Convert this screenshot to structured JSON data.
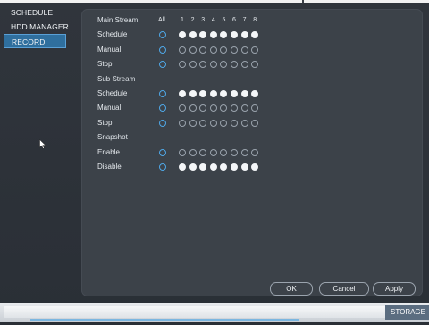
{
  "sidebar": {
    "items": [
      {
        "label": "SCHEDULE",
        "active": false
      },
      {
        "label": "HDD MANAGER",
        "active": false
      },
      {
        "label": "RECORD",
        "active": true
      }
    ]
  },
  "record": {
    "header": {
      "label": "Main Stream",
      "all_label": "All",
      "channels": [
        "1",
        "2",
        "3",
        "4",
        "5",
        "6",
        "7",
        "8"
      ]
    },
    "rows": [
      {
        "key": "main-schedule",
        "label": "Schedule",
        "all": false,
        "channels": [
          true,
          true,
          true,
          true,
          true,
          true,
          true,
          true
        ]
      },
      {
        "key": "main-manual",
        "label": "Manual",
        "all": false,
        "channels": [
          false,
          false,
          false,
          false,
          false,
          false,
          false,
          false
        ]
      },
      {
        "key": "main-stop",
        "label": "Stop",
        "all": false,
        "channels": [
          false,
          false,
          false,
          false,
          false,
          false,
          false,
          false
        ]
      },
      {
        "key": "sub-stream-heading",
        "label": "Sub Stream",
        "heading": true
      },
      {
        "key": "sub-schedule",
        "label": "Schedule",
        "all": false,
        "channels": [
          true,
          true,
          true,
          true,
          true,
          true,
          true,
          true
        ]
      },
      {
        "key": "sub-manual",
        "label": "Manual",
        "all": false,
        "channels": [
          false,
          false,
          false,
          false,
          false,
          false,
          false,
          false
        ]
      },
      {
        "key": "sub-stop",
        "label": "Stop",
        "all": false,
        "channels": [
          false,
          false,
          false,
          false,
          false,
          false,
          false,
          false
        ]
      },
      {
        "key": "snapshot-heading",
        "label": "Snapshot",
        "heading": true
      },
      {
        "key": "snap-enable",
        "label": "Enable",
        "all": false,
        "channels": [
          false,
          false,
          false,
          false,
          false,
          false,
          false,
          false
        ]
      },
      {
        "key": "snap-disable",
        "label": "Disable",
        "all": false,
        "channels": [
          true,
          true,
          true,
          true,
          true,
          true,
          true,
          true
        ]
      }
    ]
  },
  "buttons": {
    "ok": "OK",
    "cancel": "Cancel",
    "apply": "Apply"
  },
  "footer": {
    "storage_label": "STORAGE"
  },
  "colors": {
    "accent": "#4fa8e8",
    "active_item": "#2f6f9e",
    "panel": "#3c4249"
  }
}
